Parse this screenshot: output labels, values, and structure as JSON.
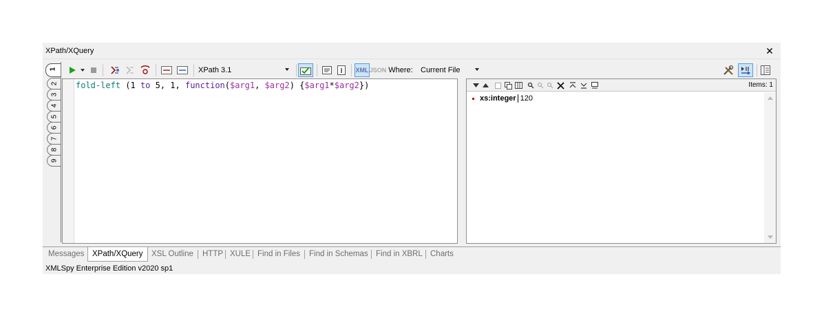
{
  "window": {
    "title": "XPath/XQuery",
    "close_glyph": "✕"
  },
  "vertical_tabs": [
    "1",
    "2",
    "3",
    "4",
    "5",
    "6",
    "7",
    "8",
    "9"
  ],
  "toolbar": {
    "version_combo": "XPath 3.1",
    "xml_label": "XML",
    "json_label": "JSON",
    "where_label": "Where:",
    "where_value": "Current File"
  },
  "editor": {
    "expression": {
      "fn": "fold-left",
      "p1": " (1 ",
      "kw1": "to",
      "p2": " 5, 1, ",
      "kw2": "function",
      "p3": "(",
      "v1": "$arg1",
      "p4": ", ",
      "v2": "$arg2",
      "p5": ") {",
      "v3": "$arg1",
      "p6": "*",
      "v4": "$arg2",
      "p7": "})"
    }
  },
  "results": {
    "items_label": "Items: 1",
    "rows": [
      {
        "type": "xs:integer",
        "value": "120"
      }
    ]
  },
  "bottom_tabs": [
    "Messages",
    "XPath/XQuery",
    "XSL Outline",
    "HTTP",
    "XULE",
    "Find in Files",
    "Find in Schemas",
    "Find in XBRL",
    "Charts"
  ],
  "status": {
    "text": "XMLSpy Enterprise Edition v2020 sp1"
  },
  "colors": {
    "accent_active_button": "#cce4f7",
    "run_green": "#1aa31a",
    "error_red": "#c00000",
    "code_teal": "#0b7d76",
    "code_purple": "#5b1d9b"
  }
}
